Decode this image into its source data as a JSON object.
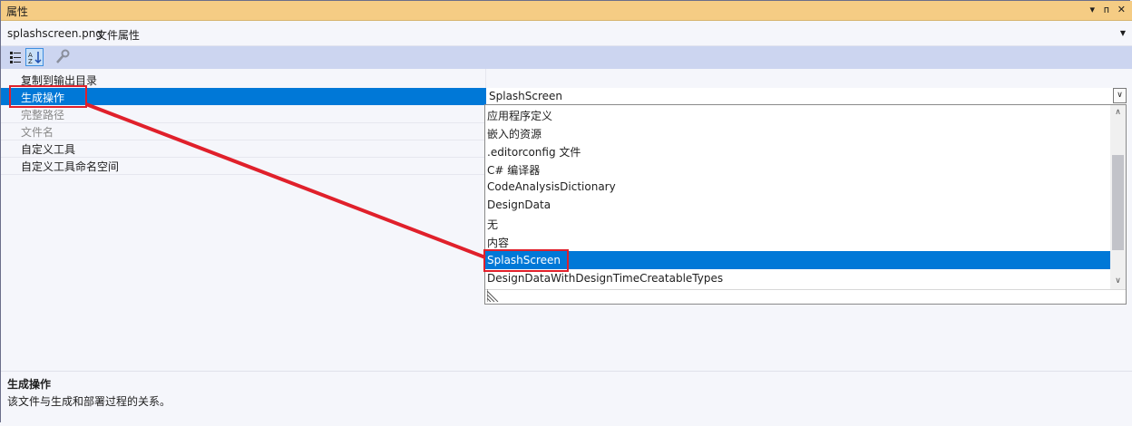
{
  "window": {
    "title": "属性",
    "controls": [
      "▾",
      "ᴨ",
      "✕"
    ]
  },
  "object": {
    "name": "splashscreen.png",
    "type": "文件属性"
  },
  "properties": [
    {
      "label": "复制到输出目录",
      "state": "normal"
    },
    {
      "label": "生成操作",
      "state": "selected"
    },
    {
      "label": "完整路径",
      "state": "disabled"
    },
    {
      "label": "文件名",
      "state": "disabled"
    },
    {
      "label": "自定义工具",
      "state": "normal"
    },
    {
      "label": "自定义工具命名空间",
      "state": "normal"
    }
  ],
  "combo": {
    "value": "SplashScreen"
  },
  "dropdown": {
    "options": [
      "应用程序定义",
      "嵌入的资源",
      ".editorconfig 文件",
      "C# 编译器",
      "CodeAnalysisDictionary",
      "DesignData",
      "无",
      "内容",
      "SplashScreen",
      "DesignDataWithDesignTimeCreatableTypes"
    ],
    "selected_index": 8
  },
  "description": {
    "title": "生成操作",
    "text": "该文件与生成和部署过程的关系。"
  },
  "colors": {
    "selection": "#0078d7",
    "titlebar": "#f5cc84",
    "annotation": "#e0202b"
  }
}
